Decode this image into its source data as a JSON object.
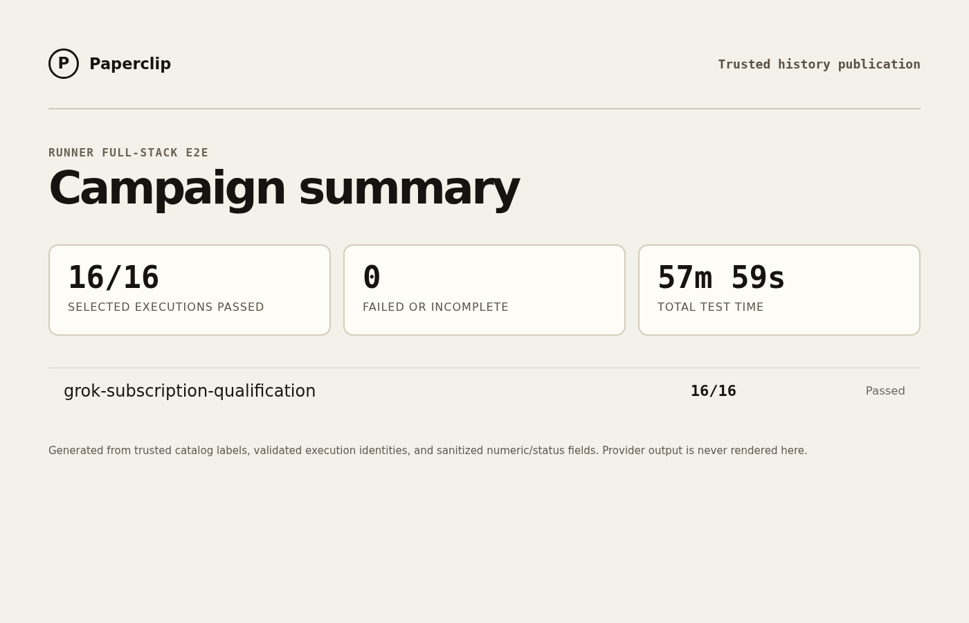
{
  "header": {
    "logo_letter": "P",
    "brand": "Paperclip",
    "tagline": "Trusted history publication"
  },
  "eyebrow": "RUNNER FULL-STACK E2E",
  "title": "Campaign summary",
  "stats": [
    {
      "value": "16/16",
      "label": "SELECTED EXECUTIONS PASSED"
    },
    {
      "value": "0",
      "label": "FAILED OR INCOMPLETE"
    },
    {
      "value": "57m 59s",
      "label": "TOTAL TEST TIME"
    }
  ],
  "results": {
    "rows": [
      {
        "name": "grok-subscription-qualification",
        "count": "16/16",
        "status": "Passed"
      }
    ]
  },
  "footnote": "Generated from trusted catalog labels, validated execution identities, and sanitized numeric/status fields. Provider output is never rendered here."
}
